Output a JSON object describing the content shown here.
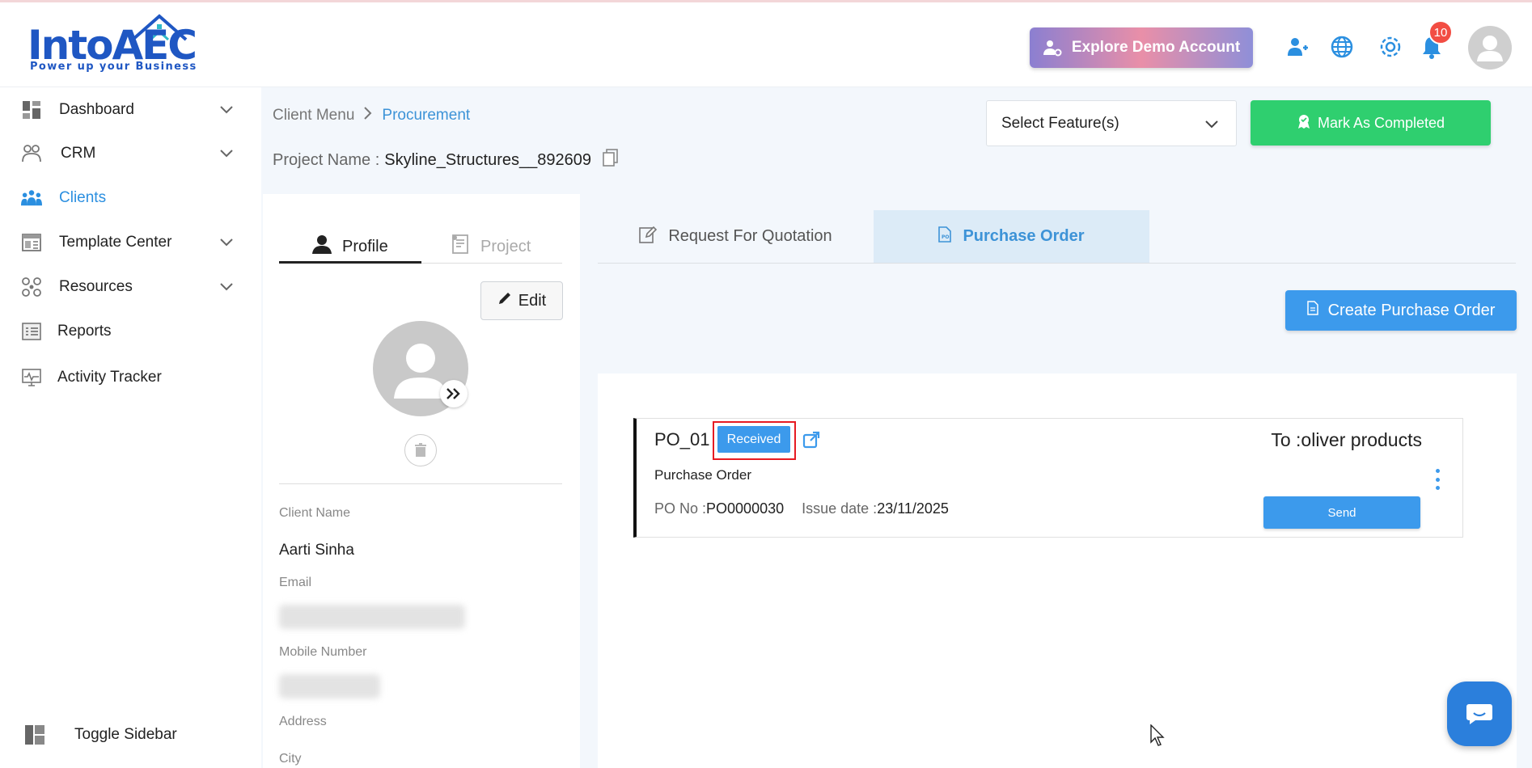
{
  "brand": {
    "logo_text": "IntoAEC",
    "tagline": "Power up your Business",
    "primary_color": "#1f57c3"
  },
  "header": {
    "demo_button_label": "Explore Demo Account",
    "notification_count": "10",
    "icons": [
      "add-user-icon",
      "globe-icon",
      "gear-icon",
      "bell-icon",
      "user-avatar"
    ]
  },
  "sidebar": {
    "items": [
      {
        "label": "Dashboard",
        "icon": "dashboard-icon",
        "has_chevron": true
      },
      {
        "label": "CRM",
        "icon": "crm-icon",
        "has_chevron": true
      },
      {
        "label": "Clients",
        "icon": "clients-icon",
        "has_chevron": false,
        "active": true
      },
      {
        "label": "Template Center",
        "icon": "template-icon",
        "has_chevron": true
      },
      {
        "label": "Resources",
        "icon": "resources-icon",
        "has_chevron": true
      },
      {
        "label": "Reports",
        "icon": "reports-icon",
        "has_chevron": false
      },
      {
        "label": "Activity Tracker",
        "icon": "activity-icon",
        "has_chevron": false
      }
    ],
    "toggle_label": "Toggle Sidebar",
    "active_color": "#2b8fe0"
  },
  "breadcrumb": {
    "root": "Client Menu",
    "current": "Procurement"
  },
  "project": {
    "label": "Project Name :",
    "name": "Skyline_Structures__892609"
  },
  "toolbar": {
    "feature_select_placeholder": "Select Feature(s)",
    "mark_completed_label": "Mark As Completed",
    "mark_completed_color": "#2fcf6f"
  },
  "profile_panel": {
    "tabs": [
      {
        "label": "Profile",
        "active": true
      },
      {
        "label": "Project",
        "active": false
      }
    ],
    "edit_label": "Edit",
    "fields": {
      "client_name_label": "Client Name",
      "client_name_value": "Aarti Sinha",
      "email_label": "Email",
      "mobile_label": "Mobile Number",
      "address_label": "Address",
      "city_label": "City"
    }
  },
  "procurement": {
    "tabs": [
      {
        "label": "Request For Quotation",
        "active": false
      },
      {
        "label": "Purchase Order",
        "active": true
      }
    ],
    "create_button_label": "Create Purchase Order",
    "accent_color": "#3c9aec"
  },
  "purchase_orders": [
    {
      "title": "PO_01",
      "status": "Received",
      "to_label": "To :",
      "to_value": "oliver products",
      "subtitle": "Purchase Order",
      "po_no_label": "PO No :",
      "po_no_value": "PO0000030",
      "issue_date_label": "Issue date :",
      "issue_date_value": "23/11/2025",
      "send_label": "Send"
    }
  ]
}
